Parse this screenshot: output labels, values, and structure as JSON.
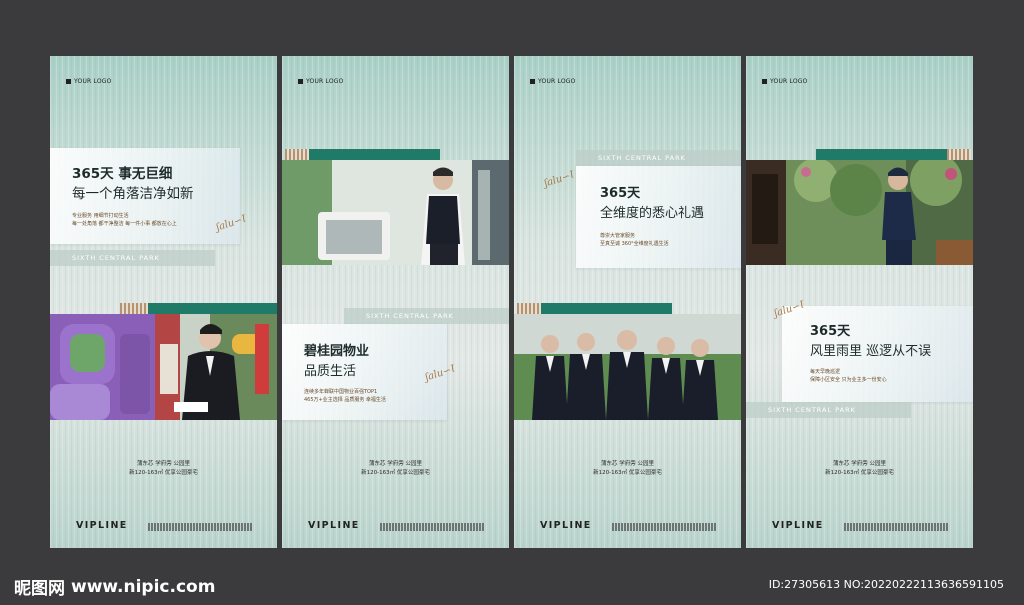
{
  "posters": [
    {
      "logo": "YOUR LOGO",
      "title_big": "365天 事无巨细",
      "title_sub": "每一个角落洁净如新",
      "lines": [
        "专业服务 用细节打动生活",
        "每一处角落 都干净整洁 每一件小事 都放在心上"
      ],
      "park": "SIXTH CENTRAL PARK",
      "foot": [
        "蒲东芯 学府旁 公园里",
        "新120-163㎡ 优享公园豪宅"
      ],
      "brand": "VIPLINE"
    },
    {
      "logo": "YOUR LOGO",
      "title_big": "碧桂园物业",
      "title_sub": "品质生活",
      "lines": [
        "连续多年蝉联中国物业百强TOP1",
        "465万+业主选择 品质服务 幸福生活"
      ],
      "park": "SIXTH CENTRAL PARK",
      "foot": [
        "蒲东芯 学府旁 公园里",
        "新120-163㎡ 优享公园豪宅"
      ],
      "brand": "VIPLINE"
    },
    {
      "logo": "YOUR LOGO",
      "title_big": "365天",
      "title_sub": "全维度的悉心礼遇",
      "lines": [
        "尊崇大管家服务",
        "至真至诚 360°全维度礼遇生活"
      ],
      "park": "SIXTH CENTRAL PARK",
      "foot": [
        "蒲东芯 学府旁 公园里",
        "新120-163㎡ 优享公园豪宅"
      ],
      "brand": "VIPLINE"
    },
    {
      "logo": "YOUR LOGO",
      "title_big": "365天",
      "title_sub": "风里雨里 巡逻从不误",
      "lines": [
        "每天早晚巡逻",
        "保障小区安全 只为业主多一份安心"
      ],
      "park": "SIXTH CENTRAL PARK",
      "foot": [
        "蒲东芯 学府旁 公园里",
        "新120-163㎡ 优享公园豪宅"
      ],
      "brand": "VIPLINE"
    }
  ],
  "watermark": {
    "site_cn": "昵图网",
    "site_url": "www.nipic.com",
    "id_text": "ID:27305613 NO:20220222113636591105"
  },
  "colors": {
    "background": "#3b3b3d",
    "accent_green": "#1f7a68",
    "accent_brown": "#b39372"
  }
}
